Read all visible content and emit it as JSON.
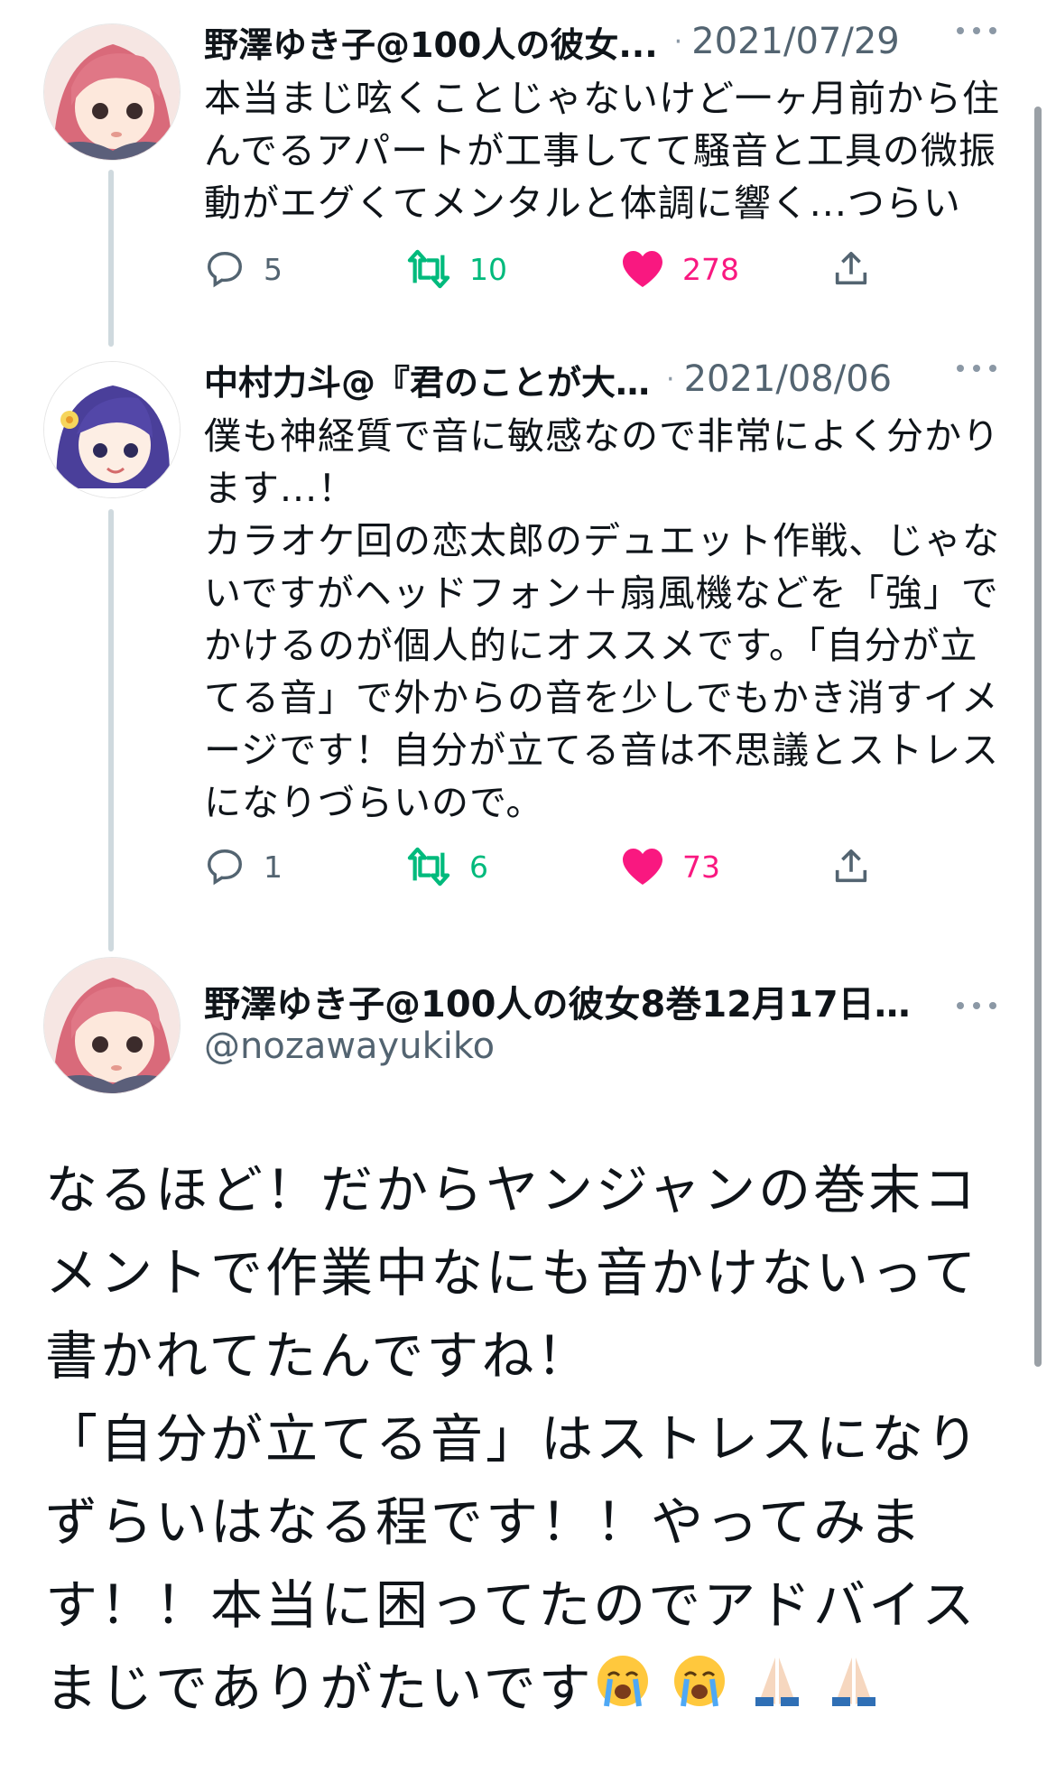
{
  "tweets": [
    {
      "name": "野澤ゆき子@100人の彼女...",
      "date": "2021/07/29",
      "text": "本当まじ呟くことじゃないけど一ヶ月前から住\nんでるアパートが工事してて騒音と工具の微振\n動がエグくてメンタルと体調に響く...つらい",
      "replies": "5",
      "retweets": "10",
      "likes": "278"
    },
    {
      "name": "中村力斗@『君のことが大…",
      "date": "2021/08/06",
      "text": "僕も神経質で音に敏感なので非常によく分かり\nます...！\nカラオケ回の恋太郎のデュエット作戦、じゃな\nいですがヘッドフォン＋扇風機などを「強」で\nかけるのが個人的にオススメです。「自分が立\nてる音」で外からの音を少しでもかき消すイメ\nージです！自分が立てる音は不思議とストレス\nになりづらいので。",
      "replies": "1",
      "retweets": "6",
      "likes": "73"
    }
  ],
  "main_tweet": {
    "name": "野澤ゆき子@100人の彼女8巻12月17日…",
    "handle": "@nozawayukiko",
    "text": "なるほど！だからヤンジャンの巻末コ\nメントで作業中なにも音かけないって\n書かれてたんですね！\n「自分が立てる音」はストレスになり\nずらいはなる程です！！やってみま\nす！！本当に困ってたのでアドバイス\nまじでありがたいです",
    "emoji": [
      "crying-face",
      "crying-face",
      "folded-hands",
      "folded-hands"
    ]
  },
  "colors": {
    "like": "#f91880",
    "retweet": "#00ba7c",
    "icon_gray": "#536471",
    "thread_line": "#cfd9de"
  }
}
